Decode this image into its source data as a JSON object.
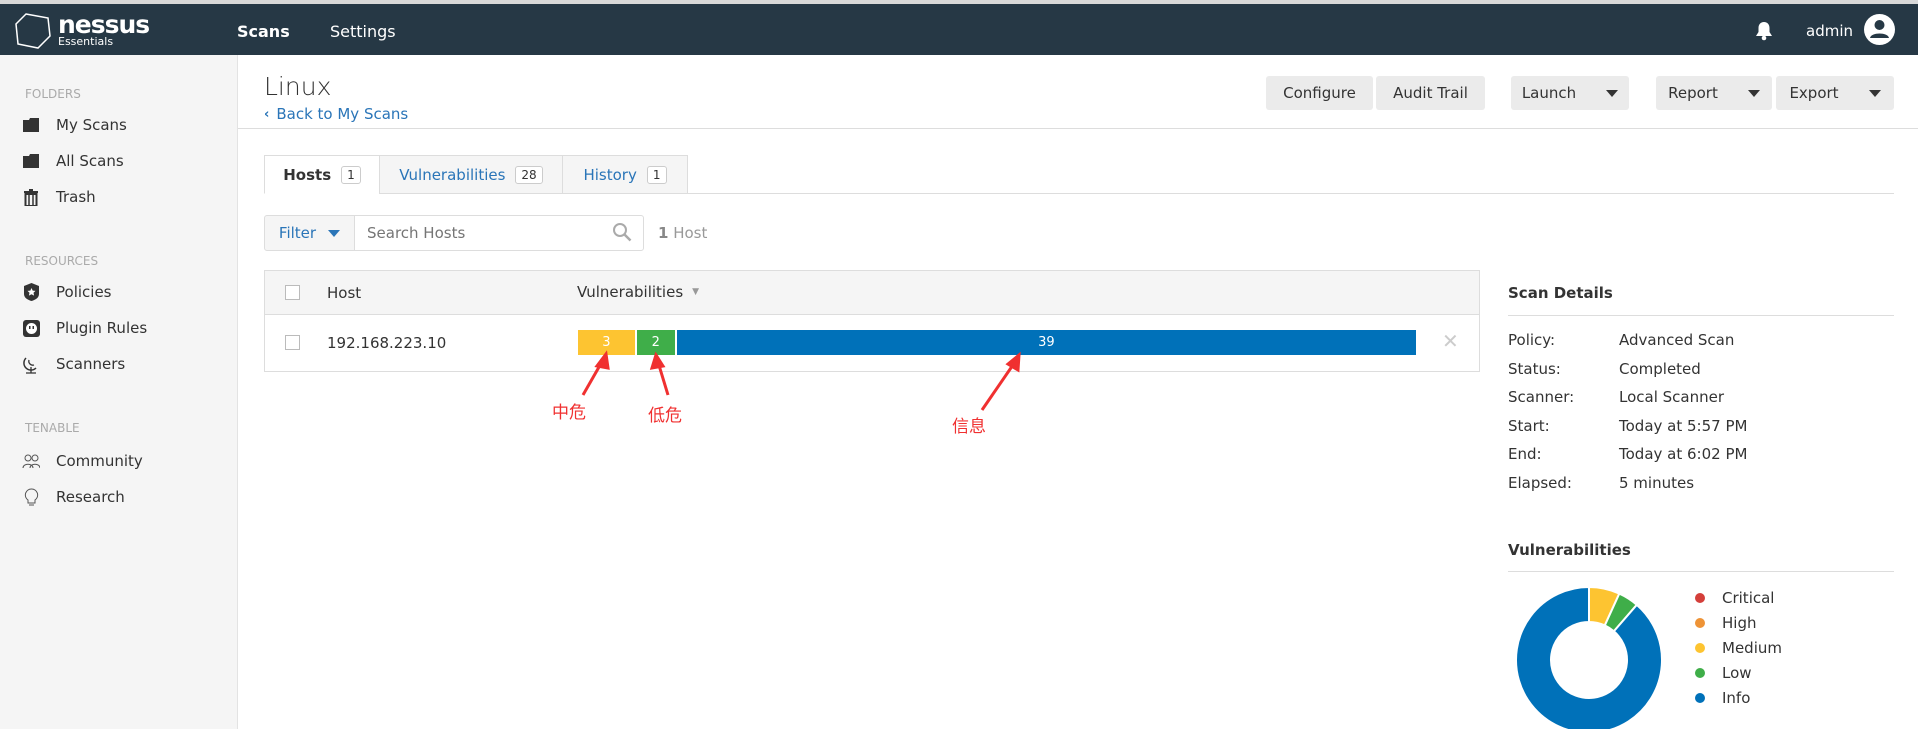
{
  "app": {
    "logo_name": "nessus",
    "logo_sub": "Essentials"
  },
  "nav": {
    "scans": "Scans",
    "settings": "Settings",
    "user": "admin"
  },
  "sidebar": {
    "folders_label": "FOLDERS",
    "folders": [
      {
        "label": "My Scans",
        "icon": "folder-icon"
      },
      {
        "label": "All Scans",
        "icon": "folder-icon"
      },
      {
        "label": "Trash",
        "icon": "trash-icon"
      }
    ],
    "resources_label": "RESOURCES",
    "resources": [
      {
        "label": "Policies",
        "icon": "shield-icon"
      },
      {
        "label": "Plugin Rules",
        "icon": "plug-icon"
      },
      {
        "label": "Scanners",
        "icon": "satellite-icon"
      }
    ],
    "tenable_label": "TENABLE",
    "tenable": [
      {
        "label": "Community",
        "icon": "community-icon"
      },
      {
        "label": "Research",
        "icon": "lightbulb-icon"
      }
    ]
  },
  "header": {
    "title": "Linux",
    "back": "Back to My Scans"
  },
  "toolbar": {
    "configure": "Configure",
    "audit": "Audit Trail",
    "launch": "Launch",
    "report": "Report",
    "export": "Export"
  },
  "tabs": [
    {
      "label": "Hosts",
      "count": "1"
    },
    {
      "label": "Vulnerabilities",
      "count": "28"
    },
    {
      "label": "History",
      "count": "1"
    }
  ],
  "filter": {
    "label": "Filter",
    "placeholder": "Search Hosts",
    "count": "1",
    "count_unit": "Host"
  },
  "table": {
    "col_host": "Host",
    "col_vulns": "Vulnerabilities",
    "rows": [
      {
        "host": "192.168.223.10",
        "medium": 3,
        "low": 2,
        "info": 39,
        "medium_label": "3",
        "low_label": "2",
        "info_label": "39"
      }
    ]
  },
  "annotations": {
    "medium": "中危",
    "low": "低危",
    "info": "信息",
    "color": "#f03030"
  },
  "scan_details": {
    "title": "Scan Details",
    "items": [
      {
        "label": "Policy:",
        "value": "Advanced Scan"
      },
      {
        "label": "Status:",
        "value": "Completed"
      },
      {
        "label": "Scanner:",
        "value": "Local Scanner"
      },
      {
        "label": "Start:",
        "value": "Today at 5:57 PM"
      },
      {
        "label": "End:",
        "value": "Today at 6:02 PM"
      },
      {
        "label": "Elapsed:",
        "value": "5 minutes"
      }
    ]
  },
  "vuln_chart": {
    "title": "Vulnerabilities",
    "type": "donut",
    "legend": [
      {
        "label": "Critical",
        "color": "#d43f3a",
        "value": 0
      },
      {
        "label": "High",
        "color": "#ee9336",
        "value": 0
      },
      {
        "label": "Medium",
        "color": "#fdc431",
        "value": 3
      },
      {
        "label": "Low",
        "color": "#3fae49",
        "value": 2
      },
      {
        "label": "Info",
        "color": "#0071b9",
        "value": 39
      }
    ]
  }
}
